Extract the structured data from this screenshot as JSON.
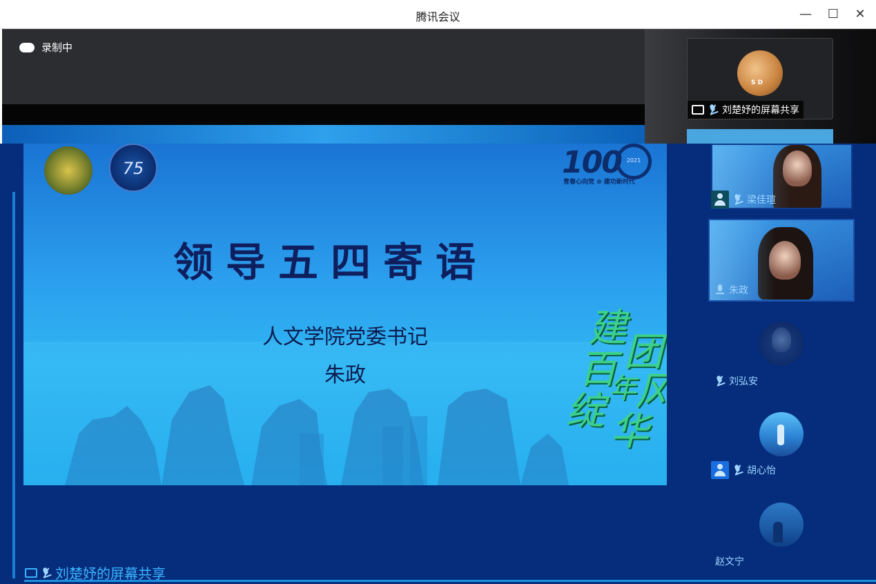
{
  "window": {
    "title": "腾讯会议",
    "minimize": "—",
    "maximize": "☐",
    "close": "✕"
  },
  "recording": {
    "label": "录制中"
  },
  "top_thumb": {
    "label": "刘楚妤的屏幕共享",
    "avatar_text": "S D"
  },
  "slide": {
    "title": "领导五四寄语",
    "subtitle": "人文学院党委书记",
    "speaker": "朱政",
    "hundred_text": "100",
    "hundred_years": "2021",
    "hundred_slogan": "青春心向党 ⊛ 建功新时代",
    "emblem_text": "75",
    "calligraphy": [
      "建",
      "团",
      "百",
      "年",
      "风",
      "华",
      "绽"
    ]
  },
  "participants": [
    {
      "name": "梁佳瑄",
      "muted": true
    },
    {
      "name": "朱政",
      "muted": false
    },
    {
      "name": "刘弘安",
      "muted": true
    },
    {
      "name": "胡心怡",
      "muted": true
    },
    {
      "name": "赵文宁",
      "muted": false
    }
  ],
  "share_banner": {
    "label": "刘楚妤的屏幕共享"
  },
  "colors": {
    "stage_bg": "#052d7b",
    "accent": "#3ab4ff",
    "title_text": "#0f1f5e"
  }
}
